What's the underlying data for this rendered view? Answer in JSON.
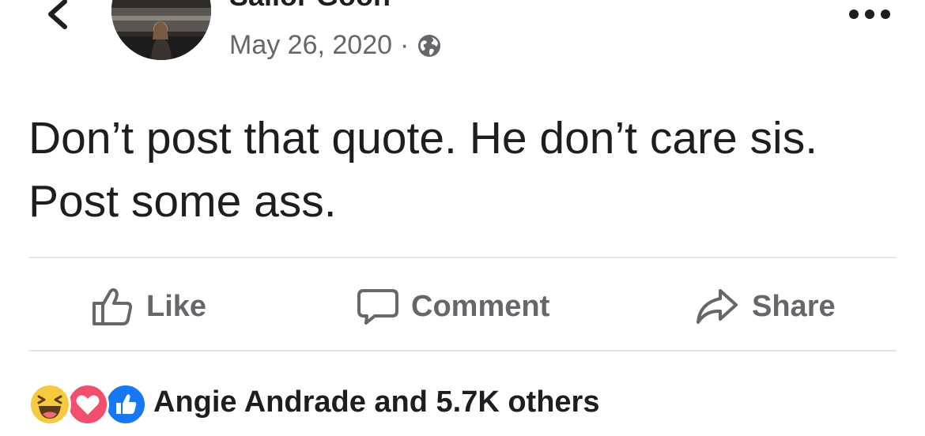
{
  "post": {
    "author": "Sailor Goon",
    "date": "May 26, 2020",
    "separator": "·",
    "privacy_icon": "globe-icon",
    "text": "Don’t post that quote. He don’t care sis. Post some ass."
  },
  "actions": {
    "like_label": "Like",
    "comment_label": "Comment",
    "share_label": "Share"
  },
  "reactions": {
    "icons": [
      "haha-reaction-icon",
      "love-reaction-icon",
      "like-reaction-icon"
    ],
    "summary": "Angie Andrade and 5.7K others"
  },
  "colors": {
    "text": "#1c1e21",
    "secondary_text": "#65676b",
    "divider": "#e4e6eb",
    "like_blue": "#1877f2",
    "love_red": "#f0506e",
    "haha_yellow": "#f7c93e"
  }
}
